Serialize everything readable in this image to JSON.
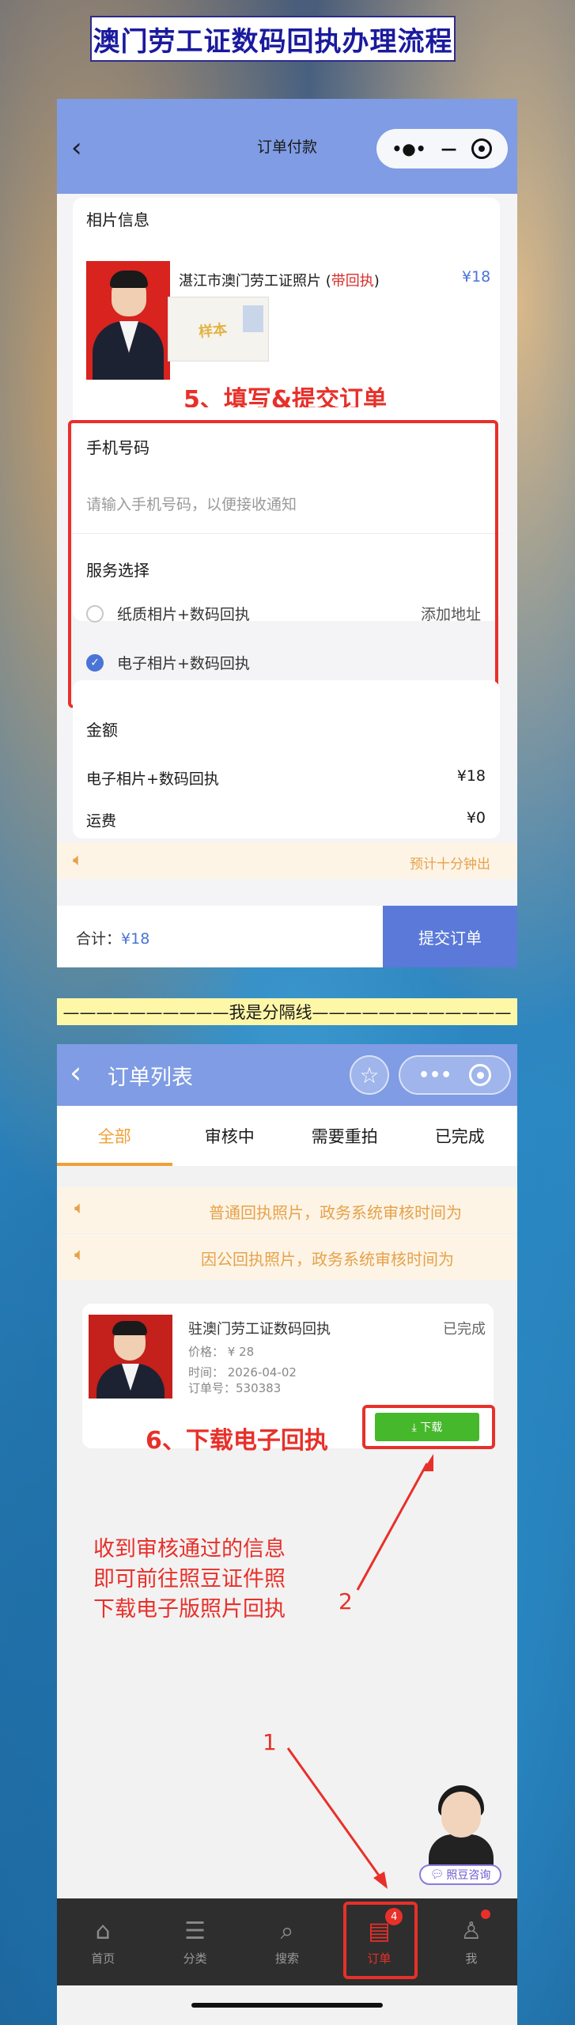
{
  "banner_title": "澳门劳工证数码回执办理流程",
  "screen1": {
    "title": "订单付款",
    "capsule_dots": "•●•",
    "capsule_minus": "—",
    "photo_section_label": "相片信息",
    "product_name_prefix": "湛江市澳门劳工证照片 (",
    "product_name_highlight": "带回执",
    "product_name_suffix": ")",
    "product_price": "¥18",
    "sample_watermark": "样本",
    "step5_label": "5、填写&提交订单",
    "phone_label": "手机号码",
    "phone_placeholder": "请输入手机号码，以便接收通知",
    "service_label": "服务选择",
    "options": [
      {
        "label": "纸质相片+数码回执",
        "checked": false,
        "extra": "添加地址"
      },
      {
        "label": "电子相片+数码回执",
        "checked": true,
        "extra": ""
      }
    ],
    "amount_label": "金额",
    "amount_rows": [
      {
        "label": "电子相片+数码回执",
        "value": "¥18"
      },
      {
        "label": "运费",
        "value": "¥0"
      }
    ],
    "notice": "预计十分钟出",
    "total_label": "合计：",
    "total_value": "¥18",
    "submit_label": "提交订单"
  },
  "divider_text": "——————————我是分隔线————————————",
  "screen2": {
    "title": "订单列表",
    "star": "☆",
    "tabs": [
      "全部",
      "审核中",
      "需要重拍",
      "已完成"
    ],
    "notices": [
      "普通回执照片，政务系统审核时间为",
      "因公回执照片，政务系统审核时间为"
    ],
    "order": {
      "title": "驻澳门劳工证数码回执",
      "status": "已完成",
      "price": "价格：  ¥ 28",
      "time": "时间：  2026-04-02",
      "order_no": "订单号：530383",
      "download_label": "⤓ 下载"
    },
    "step6_label": "6、下载电子回执",
    "hint_lines": [
      "收到审核通过的信息",
      "即可前往照豆证件照",
      "下载电子版照片回执"
    ],
    "arrow_label_2": "2",
    "arrow_label_1": "1",
    "consult_label": "照豆咨询",
    "tabbar": [
      {
        "label": "首页",
        "icon": "⌂"
      },
      {
        "label": "分类",
        "icon": "☰"
      },
      {
        "label": "搜索",
        "icon": "⌕"
      },
      {
        "label": "订单",
        "icon": "▤",
        "badge": "4"
      },
      {
        "label": "我",
        "icon": "♙"
      }
    ]
  },
  "colors": {
    "accent_red": "#e8302a",
    "header_blue": "#7f9ce4",
    "price_blue": "#4a74d6",
    "tab_orange": "#f0a035",
    "download_green": "#46b82c"
  }
}
